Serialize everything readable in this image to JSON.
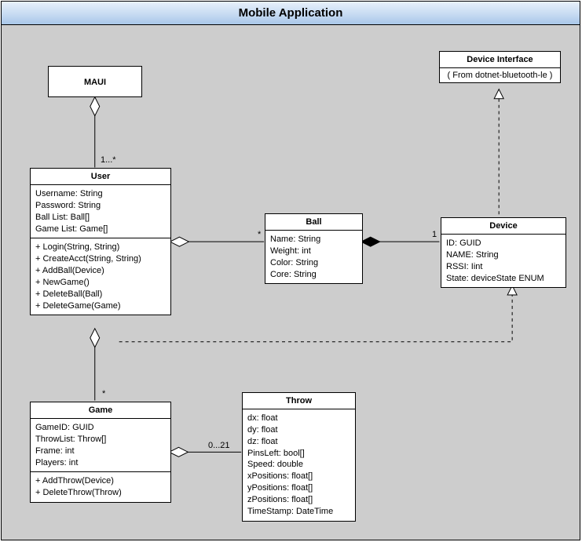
{
  "title": "Mobile Application",
  "maui": {
    "name": "MAUI"
  },
  "user": {
    "name": "User",
    "attrs": [
      "Username: String",
      "Password: String",
      "Ball List: Ball[]",
      "Game List: Game[]"
    ],
    "ops": [
      "+ Login(String, String)",
      "+ CreateAcct(String, String)",
      "+ AddBall(Device)",
      "+ NewGame()",
      "+ DeleteBall(Ball)",
      "+ DeleteGame(Game)"
    ]
  },
  "ball": {
    "name": "Ball",
    "attrs": [
      "Name: String",
      "Weight: int",
      "Color: String",
      "Core: String"
    ]
  },
  "device_iface": {
    "name": "Device Interface",
    "sub": "( From dotnet-bluetooth-le )"
  },
  "device": {
    "name": "Device",
    "attrs": [
      "ID: GUID",
      "NAME: String",
      "RSSI: Iint",
      "State: deviceState ENUM"
    ]
  },
  "game": {
    "name": "Game",
    "attrs": [
      "GameID: GUID",
      "ThrowList: Throw[]",
      "Frame: int",
      "Players: int"
    ],
    "ops": [
      "+ AddThrow(Device)",
      "+ DeleteThrow(Throw)"
    ]
  },
  "throw": {
    "name": "Throw",
    "attrs": [
      "dx: float",
      "dy: float",
      "dz: float",
      "PinsLeft: bool[]",
      "Speed: double",
      "xPositions: float[]",
      "yPositions: float[]",
      "zPositions: float[]",
      "TimeStamp: DateTime"
    ]
  },
  "mult": {
    "maui_user": "1...*",
    "user_ball": "*",
    "ball_device": "1",
    "user_game": "*",
    "game_throw": "0...21"
  }
}
